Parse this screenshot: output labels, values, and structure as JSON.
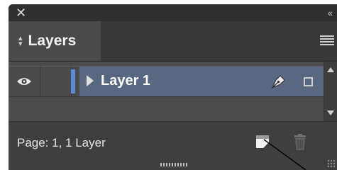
{
  "window": {
    "close_icon": "close-icon",
    "collapse_icon": "double-chevron-icon",
    "panel_color": "#4a4a4a",
    "titlebar_color": "#2f2f2f"
  },
  "tab": {
    "label": "Layers",
    "icon": "sort-arrows-icon"
  },
  "layers": [
    {
      "name": "Layer 1",
      "visible": true,
      "selected": true,
      "color": "#5b8ad6",
      "selection_color": "#586880"
    }
  ],
  "footer": {
    "status": "Page: 1, 1 Layer",
    "new_layer_icon": "new-layer-icon",
    "delete_icon": "trash-icon"
  }
}
